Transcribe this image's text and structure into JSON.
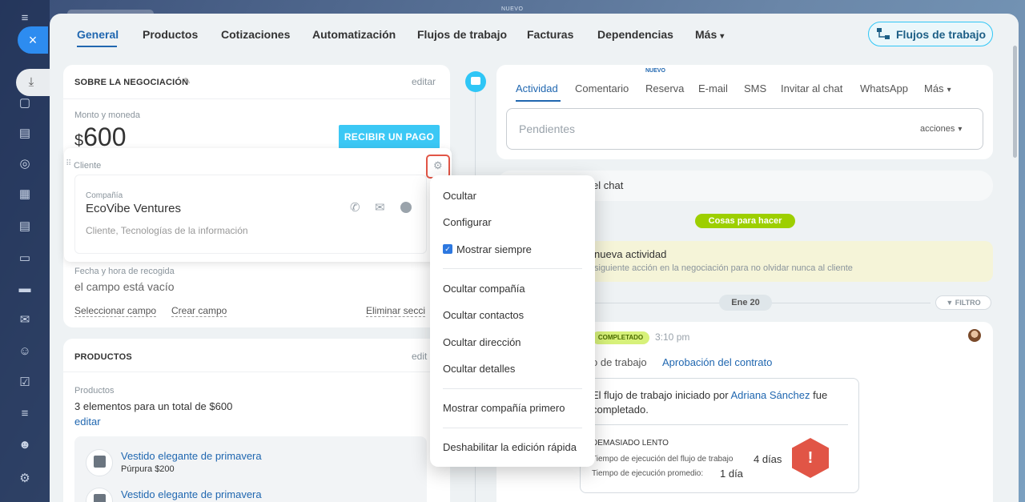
{
  "top_label": "NUEVO",
  "close_icon": "×",
  "tabs": [
    {
      "label": "General"
    },
    {
      "label": "Productos"
    },
    {
      "label": "Cotizaciones"
    },
    {
      "label": "Automatización"
    },
    {
      "label": "Flujos de trabajo"
    },
    {
      "label": "Facturas"
    },
    {
      "label": "Dependencias"
    },
    {
      "label": "Más"
    }
  ],
  "workflow_button": "Flujos de trabajo",
  "deal": {
    "title": "SOBRE LA NEGOCIACIÓN",
    "edit": "editar",
    "amount_label": "Monto y moneda",
    "currency_symbol": "$",
    "amount": "600",
    "pay_button": "RECIBIR UN PAGO",
    "client_label": "Cliente",
    "company_label": "Compañía",
    "company_name": "EcoVibe Ventures",
    "company_meta": "Cliente, Tecnologías de la información",
    "pickup_label": "Fecha y hora de recogida",
    "pickup_value": "el campo está vacío",
    "select_field": "Seleccionar campo",
    "create_field": "Crear campo",
    "delete_section": "Eliminar secci"
  },
  "products": {
    "title": "PRODUCTOS",
    "edit": "edit",
    "label": "Productos",
    "summary": "3 elementos para un total de $600",
    "edit_link": "editar",
    "items": [
      {
        "name": "Vestido elegante de primavera",
        "detail": "Púrpura  $200"
      },
      {
        "name": "Vestido elegante de primavera",
        "detail": ""
      }
    ]
  },
  "activity": {
    "nuevo": "NUEVO",
    "tabs": [
      "Actividad",
      "Comentario",
      "Reserva",
      "E-mail",
      "SMS",
      "Invitar al chat",
      "WhatsApp",
      "Más"
    ],
    "pending": "Pendientes",
    "actions": "acciones",
    "chat_text": "el chat",
    "todo_badge": "Cosas para hacer",
    "new_activity_title": "nueva actividad",
    "new_activity_sub": "siguiente acción en la negociación para no olvidar nunca al cliente",
    "date": "Ene 20",
    "filter": "FILTRO",
    "done_badge": "COMPLETADO",
    "time": "3:10 pm",
    "wf_prefix": "o de trabajo",
    "wf_name": "Aprobación del contrato",
    "wf_text_1": "El flujo de trabajo iniciado por",
    "wf_author": "Adriana Sánchez",
    "wf_text_2": "fue",
    "wf_text_3": "completado.",
    "slow_label": "DEMASIADO LENTO",
    "exec_label": "Tiempo de ejecución del flujo de trabajo",
    "exec_value": "4 días",
    "avg_label": "Tiempo de ejecución promedio:",
    "avg_value": "1 día"
  },
  "menu": {
    "items": [
      "Ocultar",
      "Configurar",
      "Mostrar siempre",
      "Ocultar compañía",
      "Ocultar contactos",
      "Ocultar dirección",
      "Ocultar detalles",
      "Mostrar compañía primero",
      "Deshabilitar la edición rápida"
    ],
    "show_always_checked": true
  },
  "colors": {
    "accent": "#2067b0",
    "pay_button": "#3bc8f5",
    "todo_badge": "#9dcf00",
    "highlight_border": "#e15546"
  }
}
